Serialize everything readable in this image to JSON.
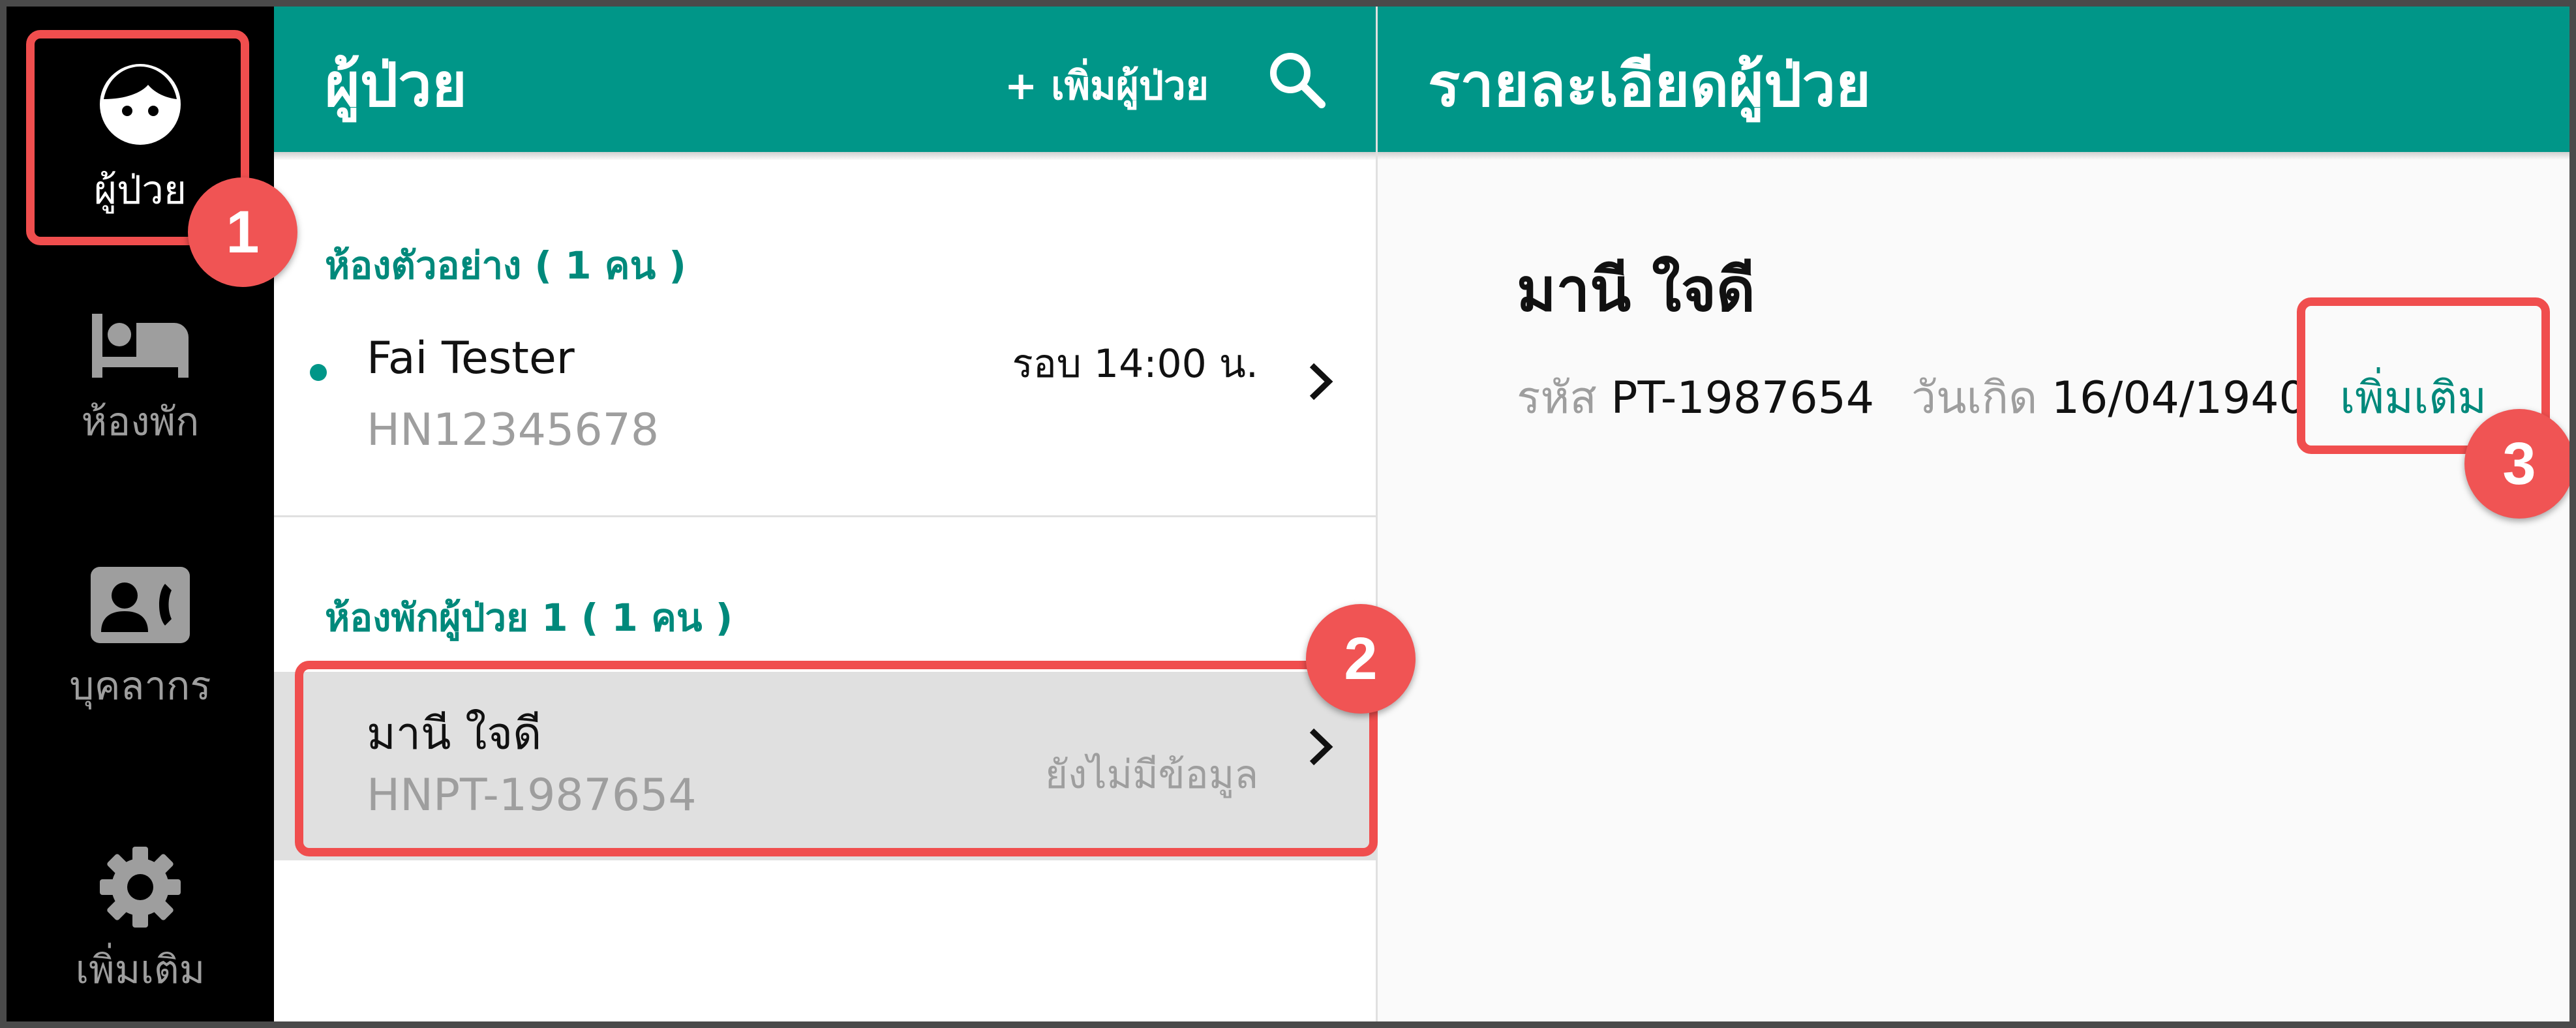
{
  "sidebar": {
    "items": [
      {
        "label": "ผู้ป่วย",
        "icon": "face-icon",
        "active": true
      },
      {
        "label": "ห้องพัก",
        "icon": "bed-icon",
        "active": false
      },
      {
        "label": "บุคลากร",
        "icon": "contact-card-icon",
        "active": false
      },
      {
        "label": "เพิ่มเติม",
        "icon": "gear-icon",
        "active": false
      }
    ]
  },
  "list_header": {
    "title": "ผู้ป่วย",
    "add_label": "+ เพิ่มผู้ป่วย",
    "search_icon": "search-icon"
  },
  "detail_header": {
    "title": "รายละเอียดผู้ป่วย"
  },
  "groups": [
    {
      "title": "ห้องตัวอย่าง ( 1 คน )",
      "patients": [
        {
          "name": "Fai Tester",
          "hn": "HN12345678",
          "meta": "รอบ 14:00 น."
        }
      ]
    },
    {
      "title": "ห้องพักผู้ป่วย 1 ( 1 คน )",
      "patients": [
        {
          "name": "มานี ใจดี",
          "hn": "HNPT-1987654",
          "meta": "ยังไม่มีข้อมูล"
        }
      ]
    }
  ],
  "detail": {
    "name": "มานี ใจดี",
    "id_label": "รหัส",
    "id_value": "PT-1987654",
    "dob_label": "วันเกิด",
    "dob_value": "16/04/1940",
    "more_label": "เพิ่มเติม"
  },
  "callouts": [
    "1",
    "2",
    "3"
  ],
  "colors": {
    "primary": "#009688",
    "primary_text": "#00897b",
    "sidebar": "#000000",
    "callout": "#f04e4e",
    "selected_row": "#e0e0e0"
  }
}
